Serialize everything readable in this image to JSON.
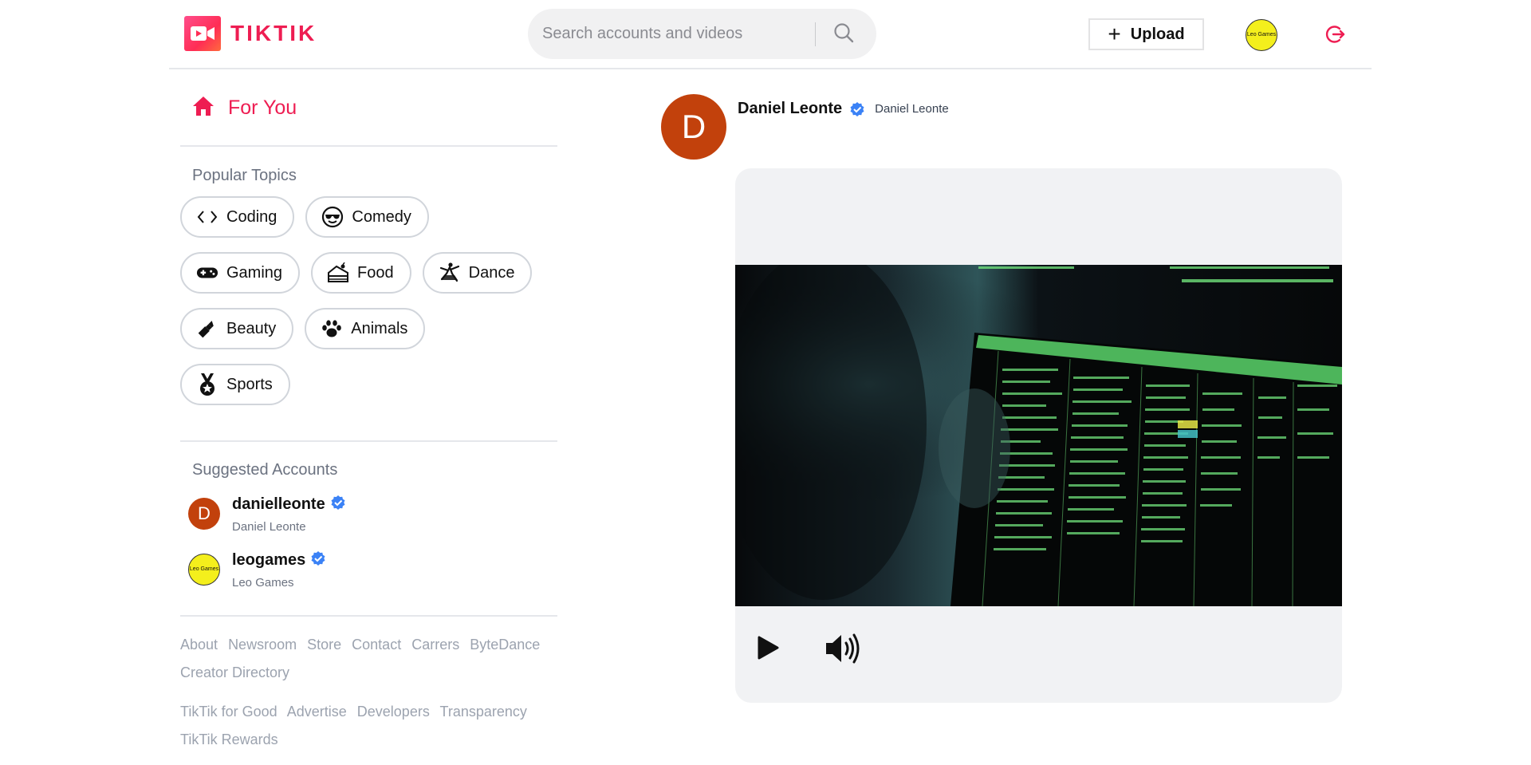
{
  "header": {
    "brand": "TIKTIK",
    "search_placeholder": "Search accounts and videos",
    "upload_label": "Upload",
    "user_avatar_text": "Leo Games"
  },
  "sidebar": {
    "for_you_label": "For You",
    "popular_topics_title": "Popular Topics",
    "topics": [
      {
        "label": "Coding",
        "icon": "code-icon"
      },
      {
        "label": "Comedy",
        "icon": "sunglasses-emoji-icon"
      },
      {
        "label": "Gaming",
        "icon": "gamepad-icon"
      },
      {
        "label": "Food",
        "icon": "cake-icon"
      },
      {
        "label": "Dance",
        "icon": "dancer-icon"
      },
      {
        "label": "Beauty",
        "icon": "lipstick-icon"
      },
      {
        "label": "Animals",
        "icon": "paw-icon"
      },
      {
        "label": "Sports",
        "icon": "medal-icon"
      }
    ],
    "suggested_title": "Suggested Accounts",
    "accounts": [
      {
        "username": "danielleonte",
        "name": "Daniel Leonte",
        "avatar_letter": "D"
      },
      {
        "username": "leogames",
        "name": "Leo Games",
        "avatar_text": "Leo Games"
      }
    ],
    "footer_links_1": [
      "About",
      "Newsroom",
      "Store",
      "Contact",
      "Carrers",
      "ByteDance",
      "Creator Directory"
    ],
    "footer_links_2": [
      "TikTik for Good",
      "Advertise",
      "Developers",
      "Transparency",
      "TikTik Rewards"
    ]
  },
  "post": {
    "avatar_letter": "D",
    "username": "Daniel Leonte",
    "display_name": "Daniel Leonte"
  },
  "colors": {
    "brand": "#ee1d52",
    "verified": "#3b82f6",
    "avatar_d": "#c2410c",
    "avatar_leo": "#f4ef1c"
  }
}
